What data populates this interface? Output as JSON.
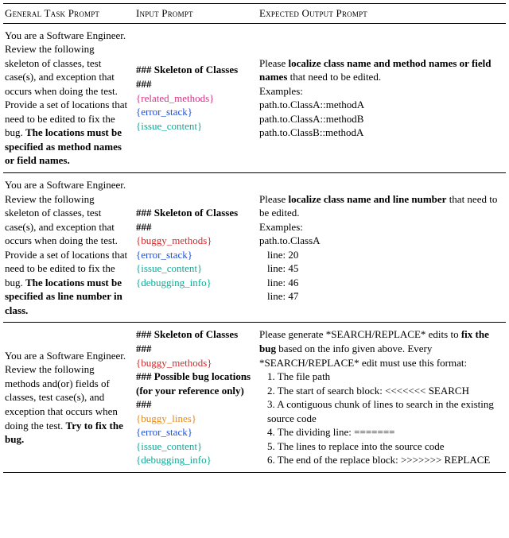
{
  "headers": {
    "general": "General Task Prompt",
    "input": "Input Prompt",
    "expected": "Expected Output Prompt"
  },
  "rows": [
    {
      "general": {
        "pre": "You are a Software Engineer. Review the following skeleton of classes, test case(s), and exception that occurs when doing the test.",
        "mid": "Provide a set of locations that need to be edited to fix the bug. ",
        "bold": "The locations must be specified as method names or field names."
      },
      "input": {
        "heading": "### Skeleton of Classes ###",
        "placeholders": [
          {
            "text": "{related_methods}",
            "cls": "ph-magenta"
          },
          {
            "text": "{error_stack}",
            "cls": "ph-blue"
          },
          {
            "text": "{issue_content}",
            "cls": "ph-teal"
          }
        ]
      },
      "expected": {
        "lead_pre": "Please ",
        "lead_bold": "localize class name and method names or field names",
        "lead_post": " that need to be edited.",
        "examples_label": "Examples:",
        "examples": [
          "path.to.ClassA::methodA",
          "path.to.ClassA::methodB",
          "path.to.ClassB::methodA"
        ]
      }
    },
    {
      "general": {
        "pre": "You are a Software Engineer. Review the following skeleton of classes, test case(s), and exception that occurs when doing the test.",
        "mid": "Provide a set of locations that need to be edited to fix the bug. ",
        "bold": "The locations must be specified as line number in class."
      },
      "input": {
        "heading": "### Skeleton of Classes ###",
        "placeholders": [
          {
            "text": "{buggy_methods}",
            "cls": "ph-red"
          },
          {
            "text": "{error_stack}",
            "cls": "ph-blue"
          },
          {
            "text": "{issue_content}",
            "cls": "ph-teal"
          },
          {
            "text": "{debugging_info}",
            "cls": "ph-teal"
          }
        ]
      },
      "expected": {
        "lead_pre": "Please ",
        "lead_bold": "localize class name and line number",
        "lead_post": " that need to be edited.",
        "examples_label": "Examples:",
        "examples": [
          "path.to.ClassA",
          "line: 20",
          "line: 45",
          "line: 46",
          "line: 47"
        ]
      }
    },
    {
      "general": {
        "pre": "You are a Software Engineer. Review the following methods and(or) fields of classes, test case(s), and exception that occurs when doing the test. ",
        "mid": "",
        "bold": "Try to fix the bug."
      },
      "input": {
        "heading": "### Skeleton of Classes ###",
        "placeholders": [
          {
            "text": "{buggy_methods}",
            "cls": "ph-red"
          }
        ],
        "heading2": "### Possible bug locations (for your reference only) ###",
        "placeholders2": [
          {
            "text": "{buggy_lines}",
            "cls": "ph-orange"
          },
          {
            "text": "{error_stack}",
            "cls": "ph-blue"
          },
          {
            "text": "{issue_content}",
            "cls": "ph-teal"
          },
          {
            "text": "{debugging_info}",
            "cls": "ph-teal"
          }
        ]
      },
      "expected": {
        "sr_pre": "Please generate *SEARCH/REPLACE* edits to ",
        "sr_bold1": "fix the bug",
        "sr_mid": " based on the info given above. Every *SEARCH/REPLACE* edit must use this format:",
        "items": [
          "1. The file path",
          "2. The start of search block: <<<<<<< SEARCH",
          "3. A contiguous chunk of lines to search in the existing source code",
          "4. The dividing line: =======",
          "5. The lines to replace into the source code",
          "6. The end of the replace block: >>>>>>> REPLACE"
        ]
      }
    }
  ]
}
